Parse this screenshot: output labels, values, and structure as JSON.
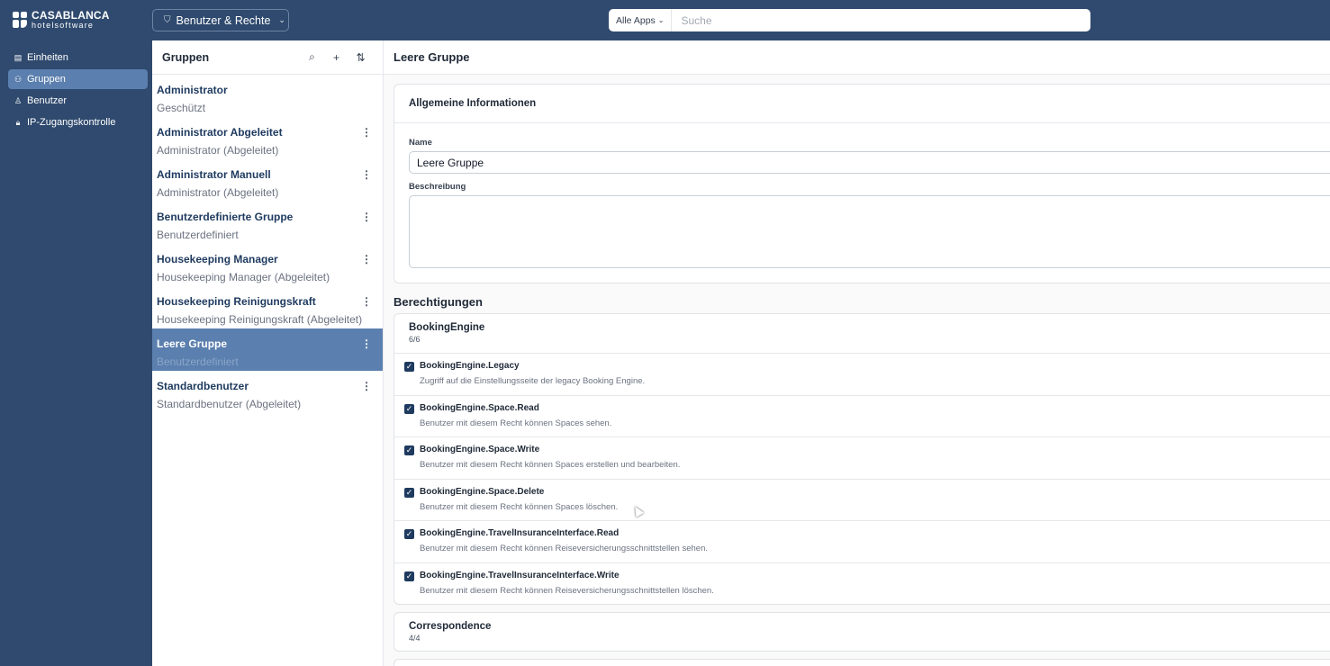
{
  "brand": {
    "name": "CASABLANCA",
    "sub": "hotelsoftware"
  },
  "header": {
    "module_label": "Benutzer & Rechte",
    "search_scope": "Alle Apps",
    "search_placeholder": "Suche"
  },
  "sidebar": {
    "items": [
      {
        "label": "Einheiten",
        "icon": "building-icon"
      },
      {
        "label": "Gruppen",
        "icon": "users-icon"
      },
      {
        "label": "Benutzer",
        "icon": "user-icon"
      },
      {
        "label": "IP-Zugangskontrolle",
        "icon": "lock-icon"
      }
    ]
  },
  "groups": {
    "title": "Gruppen",
    "items": [
      {
        "name": "Administrator",
        "subtitle": "Geschützt"
      },
      {
        "name": "Administrator Abgeleitet",
        "subtitle": "Administrator (Abgeleitet)"
      },
      {
        "name": "Administrator Manuell",
        "subtitle": "Administrator (Abgeleitet)"
      },
      {
        "name": "Benutzerdefinierte Gruppe",
        "subtitle": "Benutzerdefiniert"
      },
      {
        "name": "Housekeeping Manager",
        "subtitle": "Housekeeping Manager (Abgeleitet)"
      },
      {
        "name": "Housekeeping Reinigungskraft",
        "subtitle": "Housekeeping Reinigungskraft (Abgeleitet)"
      },
      {
        "name": "Leere Gruppe",
        "subtitle": "Benutzerdefiniert"
      },
      {
        "name": "Standardbenutzer",
        "subtitle": "Standardbenutzer (Abgeleitet)"
      }
    ]
  },
  "main": {
    "title": "Leere Gruppe",
    "general": {
      "title": "Allgemeine Informationen",
      "name_label": "Name",
      "name_value": "Leere Gruppe",
      "description_label": "Beschreibung",
      "description_value": ""
    },
    "permissions_title": "Berechtigungen",
    "permission_groups": [
      {
        "name": "BookingEngine",
        "count": "6/6",
        "permissions": [
          {
            "name": "BookingEngine.Legacy",
            "description": "Zugriff auf die Einstellungsseite der legacy Booking Engine."
          },
          {
            "name": "BookingEngine.Space.Read",
            "description": "Benutzer mit diesem Recht können Spaces sehen."
          },
          {
            "name": "BookingEngine.Space.Write",
            "description": "Benutzer mit diesem Recht können Spaces erstellen und bearbeiten."
          },
          {
            "name": "BookingEngine.Space.Delete",
            "description": "Benutzer mit diesem Recht können Spaces löschen."
          },
          {
            "name": "BookingEngine.TravelInsuranceInterface.Read",
            "description": "Benutzer mit diesem Recht können Reiseversicherungsschnittstellen sehen."
          },
          {
            "name": "BookingEngine.TravelInsuranceInterface.Write",
            "description": "Benutzer mit diesem Recht können Reiseversicherungsschnittstellen löschen."
          }
        ]
      },
      {
        "name": "Correspondence",
        "count": "4/4"
      }
    ]
  }
}
